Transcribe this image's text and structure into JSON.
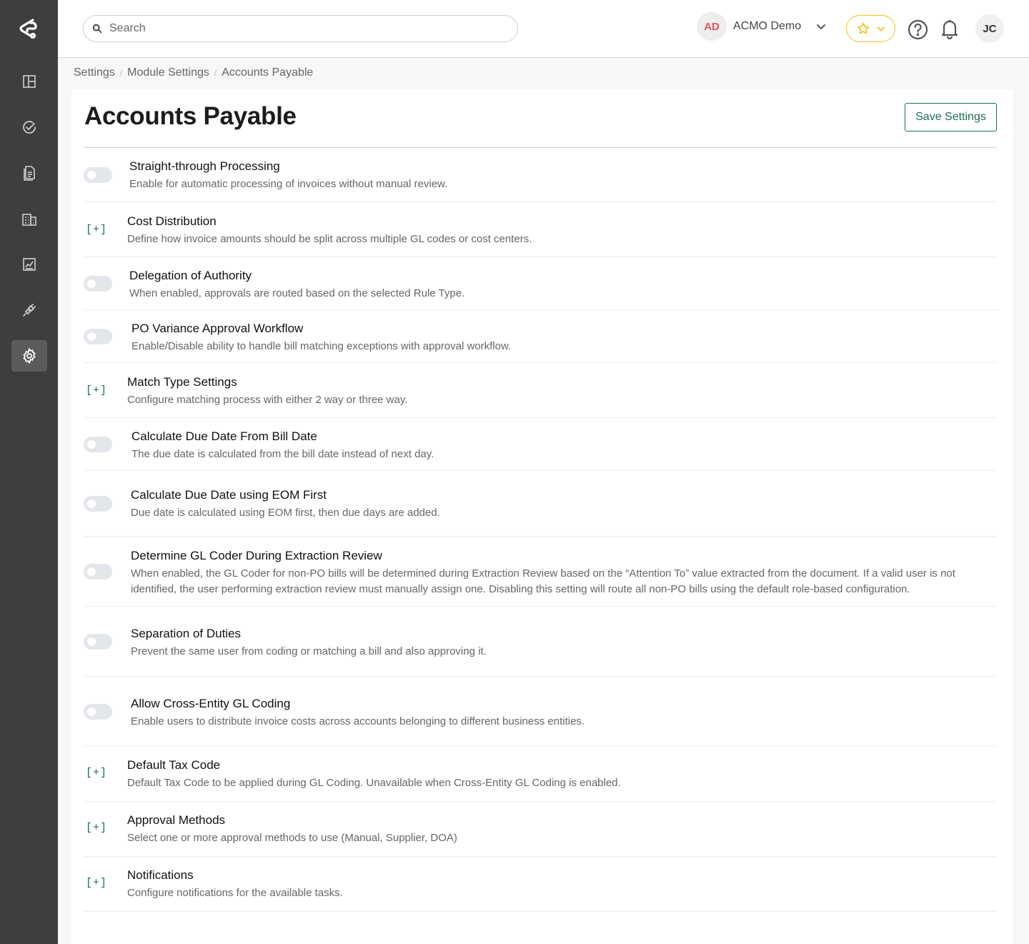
{
  "topbar": {
    "search_placeholder": "Search",
    "company_initials": "AD",
    "company_name": "ACMO Demo",
    "user_initials": "JC"
  },
  "sidebar": {
    "items": [
      {
        "icon": "dashboard-icon"
      },
      {
        "icon": "tasks-check-icon"
      },
      {
        "icon": "documents-icon"
      },
      {
        "icon": "building-icon"
      },
      {
        "icon": "analytics-icon"
      },
      {
        "icon": "integrations-plug-icon"
      },
      {
        "icon": "gear-icon",
        "active": true
      }
    ]
  },
  "breadcrumb": [
    "Settings",
    "Module Settings",
    "Accounts Payable"
  ],
  "page": {
    "title": "Accounts Payable",
    "save_label": "Save Settings"
  },
  "settings": [
    {
      "control": "toggle",
      "on": false,
      "title": "Straight-through Processing",
      "description": "Enable for automatic processing of invoices without manual review."
    },
    {
      "control": "expand",
      "expand_label": "[+]",
      "title": "Cost Distribution",
      "description": "Define how invoice amounts should be split across multiple GL codes or cost centers."
    },
    {
      "control": "toggle",
      "on": false,
      "title": "Delegation of Authority",
      "description": "When enabled, approvals are routed based on the selected Rule Type."
    },
    {
      "control": "toggle",
      "on": false,
      "title": "PO Variance Approval Workflow",
      "description": "Enable/Disable ability to handle bill matching exceptions with approval workflow."
    },
    {
      "control": "expand",
      "expand_label": "[+]",
      "title": "Match Type Settings",
      "description": "Configure matching process with either 2 way or three way."
    },
    {
      "control": "toggle",
      "on": false,
      "title": "Calculate Due Date From Bill Date",
      "description": "The due date is calculated from the bill date instead of next day."
    },
    {
      "control": "toggle",
      "on": false,
      "title": "Calculate Due Date using EOM First",
      "description": "Due date is calculated using EOM first, then due days are added."
    },
    {
      "control": "toggle",
      "on": false,
      "title": "Determine GL Coder During Extraction Review",
      "description": "When enabled, the GL Coder for non-PO bills will be determined during Extraction Review based on the “Attention To” value extracted from the document. If a valid user is not identified, the user performing extraction review must manually assign one. Disabling this setting will route all non-PO bills using the default role-based configuration."
    },
    {
      "control": "toggle",
      "on": false,
      "title": "Separation of Duties",
      "description": "Prevent the same user from coding or matching a bill and also approving it."
    },
    {
      "control": "toggle",
      "on": false,
      "title": "Allow Cross-Entity GL Coding",
      "description": "Enable users to distribute invoice costs across accounts belonging to different business entities."
    },
    {
      "control": "expand",
      "expand_label": "[+]",
      "title": "Default Tax Code",
      "description": "Default Tax Code to be applied during GL Coding. Unavailable when Cross-Entity GL Coding is enabled."
    },
    {
      "control": "expand",
      "expand_label": "[+]",
      "title": "Approval Methods",
      "description": "Select one or more approval methods to use (Manual, Supplier, DOA)"
    },
    {
      "control": "expand",
      "expand_label": "[+]",
      "title": "Notifications",
      "description": "Configure notifications for the available tasks."
    }
  ],
  "colors": {
    "accent": "#1d6e54",
    "sidebar": "#3e3e3e",
    "company_badge_text": "#e0555a",
    "favorite": "#f0c419"
  }
}
